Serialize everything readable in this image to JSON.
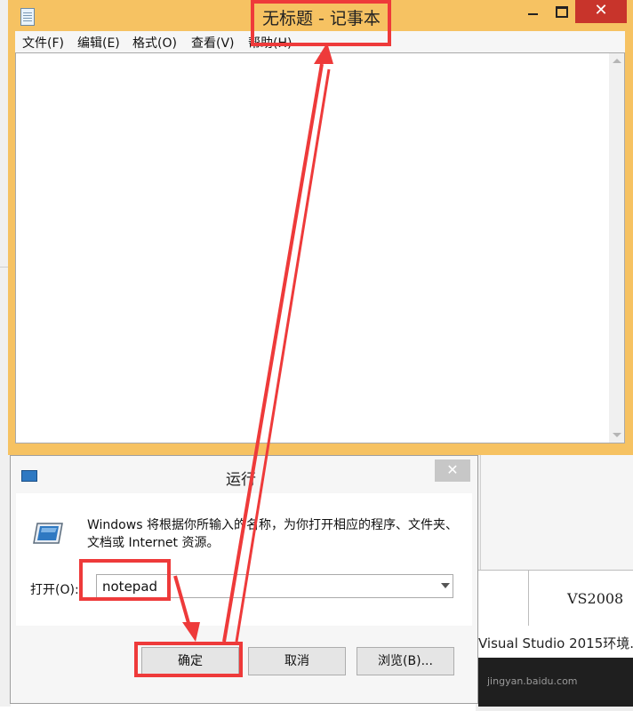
{
  "notepad": {
    "title": "无标题 - 记事本",
    "menu": [
      "文件(F)",
      "编辑(E)",
      "格式(O)",
      "查看(V)",
      "帮助(H)"
    ],
    "close_glyph": "✕"
  },
  "run_dialog": {
    "title": "运行",
    "close_glyph": "✕",
    "description": "Windows 将根据你所输入的名称，为你打开相应的程序、文件夹、文档或 Internet 资源。",
    "open_label": "打开(O):",
    "input_value": "notepad",
    "ok_label": "确定",
    "cancel_label": "取消",
    "browse_label": "浏览(B)..."
  },
  "background": {
    "table_cell": "VS2008",
    "task_text": "Visual Studio 2015环境...",
    "watermark": "jingyan.baidu.com"
  },
  "colors": {
    "notepad_frame": "#f6c262",
    "annotation": "#ee3a3a",
    "close_red": "#c8342b"
  },
  "icons": {
    "notepad": "notepad-icon",
    "run_small": "run-icon",
    "run_big": "run-large-icon",
    "dropdown": "chevron-down-icon"
  }
}
